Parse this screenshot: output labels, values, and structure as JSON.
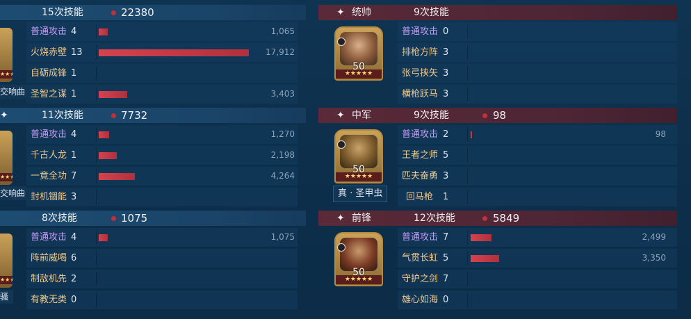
{
  "left": {
    "sections": [
      {
        "skill_count": "15次技能",
        "damage": "22380",
        "tag": "交响曲",
        "rows": [
          {
            "skill": "普通攻击",
            "n": "4",
            "value": "1,065",
            "bar": 0.06,
            "normal": true
          },
          {
            "skill": "火烧赤壁",
            "n": "13",
            "value": "17,912",
            "bar": 1.0,
            "normal": false
          },
          {
            "skill": "自砺成锋",
            "n": "1",
            "value": "",
            "bar": 0,
            "normal": false
          },
          {
            "skill": "圣智之谋",
            "n": "1",
            "value": "3,403",
            "bar": 0.19,
            "normal": false
          }
        ]
      },
      {
        "skill_count": "11次技能",
        "damage": "7732",
        "tag": "交响曲",
        "rows": [
          {
            "skill": "普通攻击",
            "n": "4",
            "value": "1,270",
            "bar": 0.07,
            "normal": true
          },
          {
            "skill": "千古人龙",
            "n": "1",
            "value": "2,198",
            "bar": 0.12,
            "normal": false
          },
          {
            "skill": "一竟全功",
            "n": "7",
            "value": "4,264",
            "bar": 0.24,
            "normal": false
          },
          {
            "skill": "封机锢能",
            "n": "3",
            "value": "",
            "bar": 0,
            "normal": false
          }
        ]
      },
      {
        "skill_count": "8次技能",
        "damage": "1075",
        "tag": "骚",
        "rows": [
          {
            "skill": "普通攻击",
            "n": "4",
            "value": "1,075",
            "bar": 0.06,
            "normal": true
          },
          {
            "skill": "阵前威喝",
            "n": "6",
            "value": "",
            "bar": 0,
            "normal": false
          },
          {
            "skill": "制敌机先",
            "n": "2",
            "value": "",
            "bar": 0,
            "normal": false
          },
          {
            "skill": "有教无类",
            "n": "0",
            "value": "",
            "bar": 0,
            "normal": false
          }
        ]
      }
    ]
  },
  "right": {
    "sections": [
      {
        "role_icon": "✦",
        "role": "统帅",
        "skill_count": "9次技能",
        "damage": "",
        "level": "50",
        "stars": "★★★★★",
        "tag": "",
        "rows": [
          {
            "skill": "普通攻击",
            "n": "0",
            "value": "",
            "bar": 0,
            "normal": true
          },
          {
            "skill": "排枪方阵",
            "n": "3",
            "value": "",
            "bar": 0,
            "normal": false
          },
          {
            "skill": "张弓挟矢",
            "n": "3",
            "value": "",
            "bar": 0,
            "normal": false
          },
          {
            "skill": "横枪跃马",
            "n": "3",
            "value": "",
            "bar": 0,
            "normal": false
          }
        ]
      },
      {
        "role_icon": "✦",
        "role": "中军",
        "skill_count": "9次技能",
        "damage": "98",
        "level": "50",
        "stars": "★★★★★",
        "tag": "真 · 圣甲虫",
        "rows": [
          {
            "skill": "普通攻击",
            "n": "2",
            "value": "98",
            "bar": 0.005,
            "normal": true
          },
          {
            "skill": "王者之师",
            "n": "5",
            "value": "",
            "bar": 0,
            "normal": false
          },
          {
            "skill": "匹夫奋勇",
            "n": "3",
            "value": "",
            "bar": 0,
            "normal": false
          },
          {
            "skill": "回马枪",
            "n": "1",
            "value": "",
            "bar": 0,
            "normal": false
          }
        ]
      },
      {
        "role_icon": "✦",
        "role": "前锋",
        "skill_count": "12次技能",
        "damage": "5849",
        "level": "50",
        "stars": "★★★★★",
        "tag": "",
        "rows": [
          {
            "skill": "普通攻击",
            "n": "7",
            "value": "2,499",
            "bar": 0.14,
            "normal": true
          },
          {
            "skill": "气贯长虹",
            "n": "5",
            "value": "3,350",
            "bar": 0.19,
            "normal": false
          },
          {
            "skill": "守护之剑",
            "n": "7",
            "value": "",
            "bar": 0,
            "normal": false
          },
          {
            "skill": "雄心如海",
            "n": "0",
            "value": "",
            "bar": 0,
            "normal": false
          }
        ]
      }
    ]
  },
  "colors": {
    "bar": "#c83a46",
    "skill": "#f2c98a",
    "normal_attack": "#c79cf5",
    "blue_header": "#1d4c72",
    "red_header": "#4d2535"
  }
}
